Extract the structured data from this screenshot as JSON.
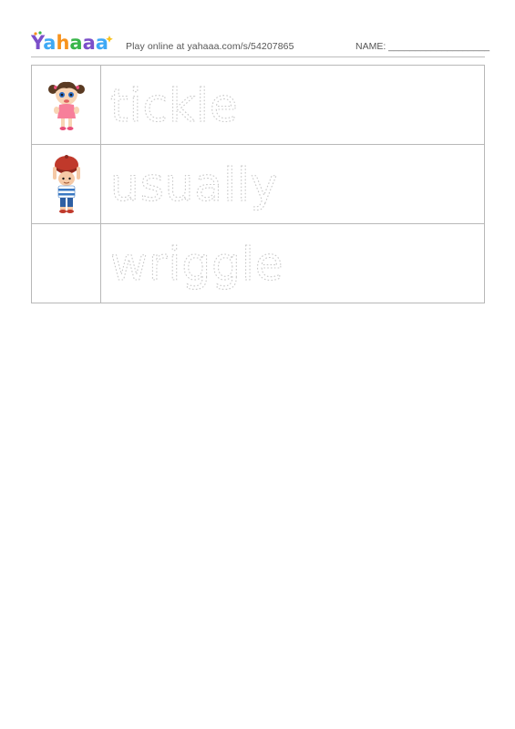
{
  "header": {
    "logo_text": "Yahaaa",
    "play_text": "Play online at yahaaa.com/s/54207865",
    "name_label": "NAME: ___________________"
  },
  "rows": [
    {
      "word": "tickle",
      "picture": "girl-icon"
    },
    {
      "word": "usually",
      "picture": "boy-with-hat-icon"
    },
    {
      "word": "wriggle",
      "picture": ""
    }
  ],
  "colors": {
    "logo_purple": "#7b4fc9",
    "logo_blue": "#3fa9f5",
    "logo_orange": "#f7931e",
    "logo_green": "#39b54a",
    "trace_gray": "#c9c9c9",
    "border_gray": "#b8b8b8"
  }
}
